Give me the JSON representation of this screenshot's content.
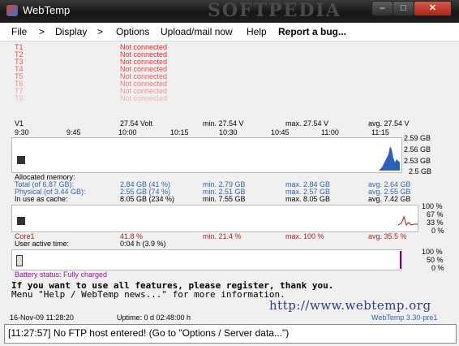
{
  "window": {
    "title": "WebTemp",
    "watermark": "SOFTPEDIA",
    "min": "–",
    "max": "□",
    "close": "✕"
  },
  "menu": [
    "File",
    ">",
    "Display",
    ">",
    "Options",
    "Upload/mail now",
    "Help",
    "Report a bug..."
  ],
  "sensors": [
    {
      "label": "T1",
      "value": "Not connected"
    },
    {
      "label": "T2",
      "value": "Not connected"
    },
    {
      "label": "T3",
      "value": "Not connected"
    },
    {
      "label": "T4",
      "value": "Not connected"
    },
    {
      "label": "T5",
      "value": "Not connected"
    },
    {
      "label": "T6",
      "value": "Not connected"
    },
    {
      "label": "T7",
      "value": "Not connected"
    },
    {
      "label": "T8",
      "value": "Not connected"
    }
  ],
  "voltage": {
    "label": "V1",
    "value": "27.54 Volt",
    "min": "min. 27.54 V",
    "max": "max. 27.54 V",
    "avg": "avg. 27.54 V"
  },
  "times": [
    "9:30",
    "9:45",
    "10:00",
    "10:15",
    "10:30",
    "10:45",
    "11:00",
    "11:15"
  ],
  "memory_scale": [
    "2.59 GB",
    "2.56 GB",
    "2.53 GB",
    "2.5 GB"
  ],
  "memory": {
    "heading": "Allocated memory:",
    "rows": [
      {
        "label": "Total (of 6.87 GB):",
        "value": "2.84 GB (41 %)",
        "min": "min. 2.79 GB",
        "max": "max. 2.84 GB",
        "avg": "avg. 2.64 GB"
      },
      {
        "label": "Physical (of 3.44 GB):",
        "value": "2.55 GB (74 %)",
        "min": "min. 2.51 GB",
        "max": "max. 2.57 GB",
        "avg": "avg. 2.55 GB"
      },
      {
        "label": "In use as cache:",
        "value": "8.05 GB (234 %)",
        "min": "min. 7.55 GB",
        "max": "max. 8.05 GB",
        "avg": "avg. 7.42 GB"
      }
    ]
  },
  "cpu_scale": [
    "100 %",
    "67 %",
    "33 %",
    "0 %"
  ],
  "cpu": {
    "label": "Core1",
    "value": "41.8 %",
    "min": "min. 21.4 %",
    "max": "max. 100 %",
    "avg": "avg. 35.5 %"
  },
  "active": {
    "label": "User active time:",
    "value": "0:04 h (3.9 %)"
  },
  "battery_scale": [
    "100 %",
    "50 %",
    "0 %"
  ],
  "battery": {
    "status": "Battery status: Fully charged",
    "level": 1.0
  },
  "register": [
    "If you want to use all features, please register, thank you.",
    "Menu \"Help / WebTemp news...\" for more information."
  ],
  "url": "http://www.webtemp.org",
  "footer": {
    "date": "16-Nov-09 11:28:20",
    "uptime": "Uptime: 0 d 02:48:00 h",
    "version": "WebTemp 3.30-pre1"
  },
  "status": "[11:27:57] No FTP host entered! (Go to \"Options / Server data...\")",
  "colors": {
    "accent": "#2b62b8",
    "alert": "#e82020",
    "battery": "#800080"
  }
}
